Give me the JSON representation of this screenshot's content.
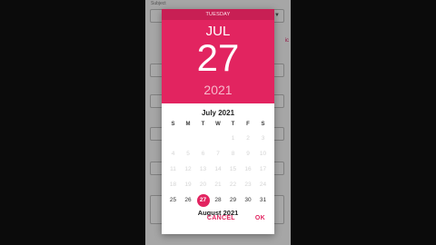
{
  "background": {
    "top_label": "Subject",
    "accent_text": "ic",
    "dropdown_arrow": "▼"
  },
  "dialog": {
    "weekday": "TUESDAY",
    "month": "JUL",
    "day": "27",
    "year": "2021",
    "calendar_title": "July 2021",
    "days_of_week": [
      "S",
      "M",
      "T",
      "W",
      "T",
      "F",
      "S"
    ],
    "weeks": [
      [
        "",
        "",
        "",
        "",
        "1",
        "2",
        "3"
      ],
      [
        "4",
        "5",
        "6",
        "7",
        "8",
        "9",
        "10"
      ],
      [
        "11",
        "12",
        "13",
        "14",
        "15",
        "16",
        "17"
      ],
      [
        "18",
        "19",
        "20",
        "21",
        "22",
        "23",
        "24"
      ],
      [
        "25",
        "26",
        "27",
        "28",
        "29",
        "30",
        "31"
      ]
    ],
    "selected_day": "27",
    "next_month_title": "August 2021",
    "cancel_label": "CANCEL",
    "ok_label": "OK"
  },
  "colors": {
    "accent": "#e22460",
    "accent_dark": "#c81f54"
  }
}
